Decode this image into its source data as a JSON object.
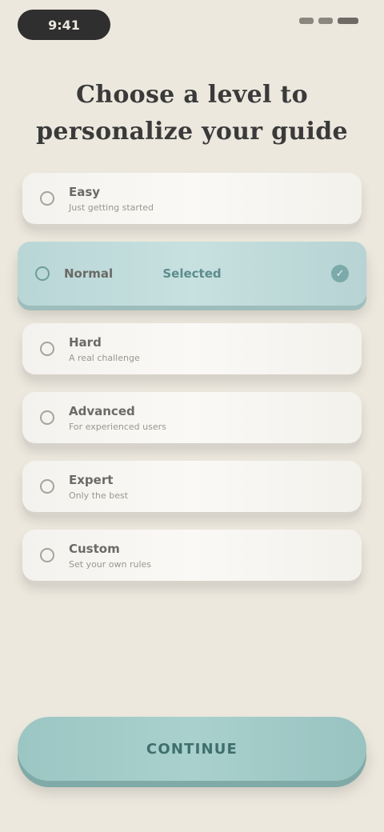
{
  "status_bar": {
    "time": "9:41"
  },
  "title": {
    "line1": "Choose a level to",
    "line2": "personalize your guide"
  },
  "options": [
    {
      "label": "Easy",
      "sub": "Just getting started",
      "selected": false
    },
    {
      "label": "Normal",
      "sub": "",
      "note": "Selected",
      "selected": true
    },
    {
      "label": "Hard",
      "sub": "A real challenge",
      "selected": false
    },
    {
      "label": "Advanced",
      "sub": "For experienced users",
      "selected": false
    },
    {
      "label": "Expert",
      "sub": "Only the best",
      "selected": false
    },
    {
      "label": "Custom",
      "sub": "Set your own rules",
      "selected": false
    }
  ],
  "cta": {
    "label": "CONTINUE"
  },
  "colors": {
    "background": "#ECE8DE",
    "accent": "#A9D0CD",
    "selected": "#C7E0E0"
  }
}
